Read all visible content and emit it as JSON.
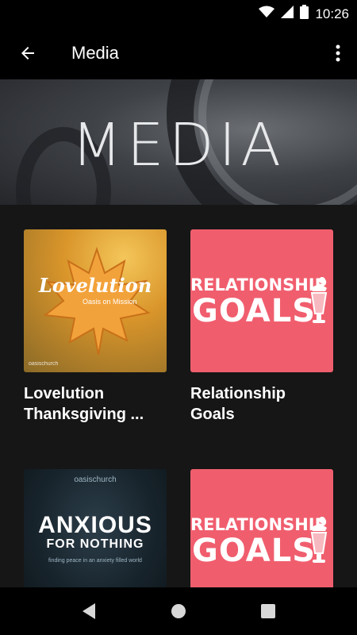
{
  "status_bar": {
    "time": "10:26",
    "icons": [
      "wifi-icon",
      "cell-signal-icon",
      "battery-icon"
    ]
  },
  "app_bar": {
    "title": "Media",
    "back_icon": "arrow-back-icon",
    "menu_icon": "more-vert-icon"
  },
  "banner": {
    "text": "MEDIA"
  },
  "cards": [
    {
      "title": "Lovelution Thanksgiving ...",
      "art": {
        "headline": "Lovelution",
        "subtitle": "Oasis on Mission",
        "logo": "oasischurch"
      }
    },
    {
      "title": "Relationship Goals",
      "art": {
        "line1": "RELATIONSHIP",
        "line2": "GOALS"
      }
    },
    {
      "title": "",
      "art": {
        "logo": "oasischurch",
        "line1": "ANXIOUS",
        "line2": "FOR NOTHING",
        "subtitle": "finding peace in an anxiety filled world"
      }
    },
    {
      "title": "",
      "art": {
        "line1": "RELATIONSHIP",
        "line2": "GOALS"
      }
    }
  ],
  "colors": {
    "background": "#161616",
    "relationship_pink": "#f05e6e",
    "bar": "#000000"
  },
  "nav_bar": {
    "icons": [
      "back-triangle-icon",
      "home-circle-icon",
      "recents-square-icon"
    ]
  }
}
